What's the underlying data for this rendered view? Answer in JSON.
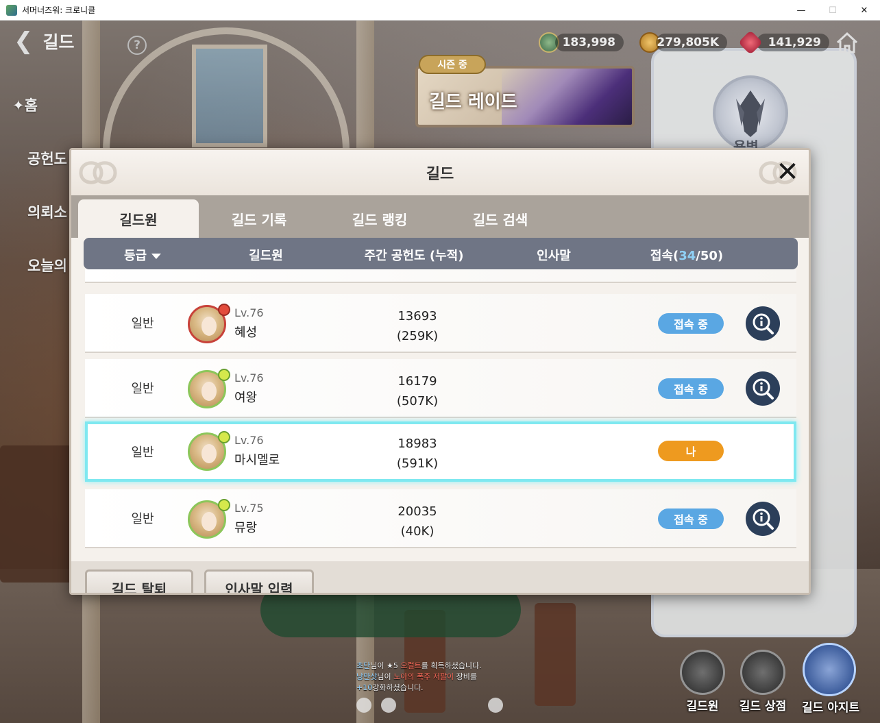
{
  "window": {
    "title": "서머너즈워: 크로니클",
    "minimize": "—",
    "maximize": "☐",
    "close": "✕"
  },
  "topbar": {
    "back_label": "길드",
    "help": "?",
    "currencies": [
      {
        "icon": "guild-coin-icon",
        "value": "183,998"
      },
      {
        "icon": "gold-coin-icon",
        "value": "279,805K"
      },
      {
        "icon": "red-crystal-icon",
        "value": "141,929"
      }
    ]
  },
  "side_menu": [
    {
      "label": "✦홈"
    },
    {
      "label": "공헌도"
    },
    {
      "label": "의뢰소"
    },
    {
      "label": "오늘의"
    }
  ],
  "raid_banner": {
    "badge": "시즌 중",
    "title": "길드 레이드"
  },
  "right_panel": {
    "emblem_label": "용병"
  },
  "modal": {
    "title": "길드",
    "close": "✕",
    "tabs": [
      {
        "label": "길드원",
        "active": true
      },
      {
        "label": "길드 기록",
        "active": false
      },
      {
        "label": "길드 랭킹",
        "active": false
      },
      {
        "label": "길드 검색",
        "active": false
      }
    ],
    "columns": {
      "rank": "등급",
      "member": "길드원",
      "contribution": "주간 공헌도 (누적)",
      "greeting": "인사말",
      "online_prefix": "접속(",
      "online_count": "34",
      "online_suffix": "/50)"
    },
    "members": [
      {
        "rank": "일반",
        "level": "Lv.76",
        "name": "혜성",
        "weekly": "13693",
        "total": "(259K)",
        "status": "접속 중",
        "is_me": false,
        "badge": "red"
      },
      {
        "rank": "일반",
        "level": "Lv.76",
        "name": "여왕",
        "weekly": "16179",
        "total": "(507K)",
        "status": "접속 중",
        "is_me": false,
        "badge": "green"
      },
      {
        "rank": "일반",
        "level": "Lv.76",
        "name": "마시멜로",
        "weekly": "18983",
        "total": "(591K)",
        "status": "나",
        "is_me": true,
        "badge": "green"
      },
      {
        "rank": "일반",
        "level": "Lv.75",
        "name": "뮤랑",
        "weekly": "20035",
        "total": "(40K)",
        "status": "접속 중",
        "is_me": false,
        "badge": "green"
      }
    ],
    "buttons": {
      "leave": "길드 탈퇴",
      "greeting_input": "인사말 입력"
    }
  },
  "chat_log": {
    "line1_name": "초단",
    "line1_mid": "님이 ★5 ",
    "line1_item": "오럴트",
    "line1_end": "를 획득하셨습니다.",
    "line2_name": "낭만샷",
    "line2_mid": "님이 ",
    "line2_item": "노아의 폭주 저팔이",
    "line2_end": " 장비를",
    "line3_level": "+10",
    "line3_end": "강화하셨습니다."
  },
  "bottom_nav": [
    {
      "label": "길드원",
      "icon": "guild-member-icon"
    },
    {
      "label": "길드 상점",
      "icon": "basket-icon"
    },
    {
      "label": "길드 아지트",
      "icon": "guild-hideout-icon"
    }
  ]
}
